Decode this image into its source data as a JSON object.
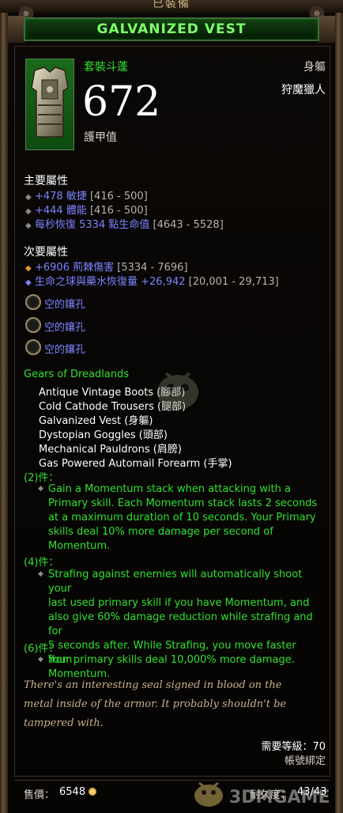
{
  "top_label": "已裝備",
  "title": "GALVANIZED VEST",
  "item": {
    "set_type": "套裝斗蓬",
    "slot": "身軀",
    "class_requirement": "狩魔獵人",
    "armor_value": "672",
    "armor_label": "護甲值"
  },
  "primary": {
    "title": "主要屬性",
    "affixes": [
      {
        "text": "+478 敏捷",
        "range": "[416 - 500]"
      },
      {
        "text": "+444 體能",
        "range": "[416 - 500]"
      },
      {
        "text": "每秒恢復 5334 點生命值",
        "range": "[4643 - 5528]"
      }
    ]
  },
  "secondary": {
    "title": "次要屬性",
    "affixes": [
      {
        "text": "+6906 荊棘傷害",
        "range": "[5334 - 7696]"
      },
      {
        "text": "生命之球與藥水恢復量 +26,942",
        "range": "[20,001 - 29,713]"
      }
    ]
  },
  "sockets": [
    "空的鑲孔",
    "空的鑲孔",
    "空的鑲孔"
  ],
  "set": {
    "name": "Gears of Dreadlands",
    "pieces": [
      "Antique Vintage Boots (腳部)",
      "Cold Cathode Trousers (腿部)",
      "Galvanized Vest (身軀)",
      "Dystopian Goggles (頭部)",
      "Mechanical Pauldrons (肩膀)",
      "Gas Powered Automail Forearm (手掌)"
    ],
    "bonuses": [
      {
        "header": "(2)件：",
        "lines": [
          "Gain a Momentum stack when attacking with a",
          "Primary skill. Each Momentum stack lasts 2 seconds",
          "at a maximum duration of 10 seconds. Your Primary",
          "skills deal 10% more damage per second of",
          "Momentum."
        ]
      },
      {
        "header": "(4)件：",
        "lines": [
          "Strafing against enemies will automatically shoot your",
          "last used primary skill if you have Momentum, and",
          "also give 60% damage reduction while strafing and for",
          "5 seconds after. While Strafing, you move faster from",
          "Momentum."
        ]
      },
      {
        "header": "(6)件：",
        "lines": [
          "Your primary skills deal 10,000% more damage."
        ]
      }
    ]
  },
  "flavor": [
    "There's an interesting seal signed in blood on the",
    "metal inside of the armor. It probably shouldn't be",
    "tampered with."
  ],
  "level_requirement": "需要等級：70",
  "account_bound": "帳號綁定",
  "sell": {
    "label": "售價：",
    "value": "6548"
  },
  "durability": {
    "label": "耐久度：",
    "value": "43/43"
  },
  "watermark": "3DMGAME",
  "colors": {
    "set_green": "#2fe02f",
    "magic_blue": "#7b84ff",
    "flavor_tan": "#c8b089",
    "title_green": "#7fff6a"
  }
}
